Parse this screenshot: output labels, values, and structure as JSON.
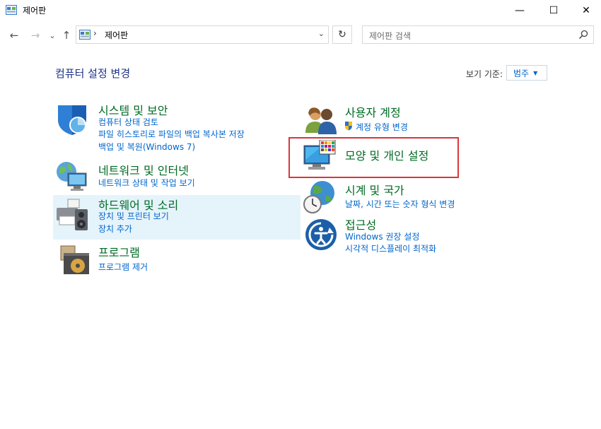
{
  "window": {
    "title": "제어판",
    "minimize": "—",
    "maximize": "☐",
    "close": "✕"
  },
  "nav": {
    "back": "←",
    "forward": "→",
    "recent": "⌄",
    "up": "↑",
    "address_separator": "›",
    "address_text": "제어판",
    "dropdown": "⌄",
    "refresh": "↻",
    "search_placeholder": "제어판 검색"
  },
  "header": {
    "heading": "컴퓨터 설정 변경",
    "view_by_label": "보기 기준:",
    "view_by_value": "범주",
    "view_by_arrow": "▼"
  },
  "categories": {
    "system": {
      "icon": "shield-icon",
      "title": "시스템 및 보안",
      "links": [
        "컴퓨터 상태 검토",
        "파일 히스토리로 파일의 백업 복사본 저장",
        "백업 및 복원(Windows 7)"
      ]
    },
    "network": {
      "icon": "network-globe-icon",
      "title": "네트워크 및 인터넷",
      "links": [
        "네트워크 상태 및 작업 보기"
      ]
    },
    "hardware": {
      "icon": "printer-speaker-icon",
      "title": "하드웨어 및 소리",
      "links": [
        "장치 및 프린터 보기",
        "장치 추가"
      ]
    },
    "programs": {
      "icon": "programs-disc-icon",
      "title": "프로그램",
      "links": [
        "프로그램 제거"
      ]
    },
    "users": {
      "icon": "users-icon",
      "title": "사용자 계정",
      "links": [
        "계정 유형 변경"
      ]
    },
    "appearance": {
      "icon": "monitor-palette-icon",
      "title": "모양 및 개인 설정",
      "links": []
    },
    "clock": {
      "icon": "clock-globe-icon",
      "title": "시계 및 국가",
      "links": [
        "날짜, 시간 또는 숫자 형식 변경"
      ]
    },
    "access": {
      "icon": "accessibility-icon",
      "title": "접근성",
      "links": [
        "Windows 권장 설정",
        "시각적 디스플레이 최적화"
      ]
    }
  },
  "colors": {
    "category_title": "#006b25",
    "link": "#0066cc",
    "heading": "#1e3287",
    "hover_background": "#e5f3fb",
    "annotation_box": "#d9363b"
  }
}
